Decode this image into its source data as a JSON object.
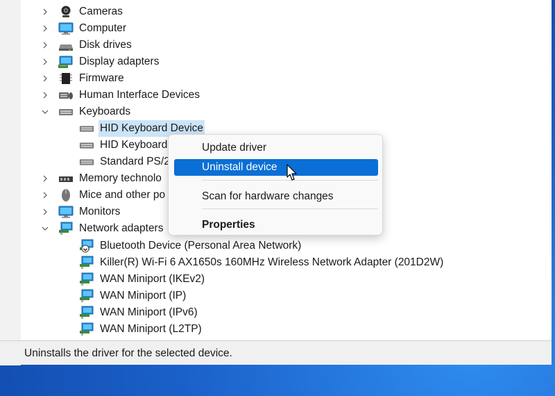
{
  "tree": {
    "categories": [
      {
        "label": "Cameras",
        "icon": "camera-icon",
        "expanded": false
      },
      {
        "label": "Computer",
        "icon": "monitor-icon",
        "expanded": false
      },
      {
        "label": "Disk drives",
        "icon": "disk-drive-icon",
        "expanded": false
      },
      {
        "label": "Display adapters",
        "icon": "display-adapter-icon",
        "expanded": false
      },
      {
        "label": "Firmware",
        "icon": "chip-icon",
        "expanded": false
      },
      {
        "label": "Human Interface Devices",
        "icon": "hid-icon",
        "expanded": false
      },
      {
        "label": "Keyboards",
        "icon": "keyboard-icon",
        "expanded": true
      },
      {
        "label": "Memory technolo",
        "icon": "memory-icon",
        "expanded": false
      },
      {
        "label": "Mice and other po",
        "icon": "mouse-icon",
        "expanded": false
      },
      {
        "label": "Monitors",
        "icon": "monitor-icon",
        "expanded": false
      },
      {
        "label": "Network adapters",
        "icon": "network-icon",
        "expanded": true
      }
    ],
    "keyboards": [
      {
        "label": "HID Keyboard Device",
        "selected": true
      },
      {
        "label": "HID Keyboard"
      },
      {
        "label": "Standard PS/2"
      }
    ],
    "network_adapters": [
      {
        "label": "Bluetooth Device (Personal Area Network)"
      },
      {
        "label": "Killer(R) Wi-Fi 6 AX1650s 160MHz Wireless Network Adapter (201D2W)"
      },
      {
        "label": "WAN Miniport (IKEv2)"
      },
      {
        "label": "WAN Miniport (IP)"
      },
      {
        "label": "WAN Miniport (IPv6)"
      },
      {
        "label": "WAN Miniport (L2TP)"
      }
    ]
  },
  "context_menu": {
    "update_driver": "Update driver",
    "uninstall_device": "Uninstall device",
    "scan_hardware": "Scan for hardware changes",
    "properties": "Properties"
  },
  "status_bar": {
    "text": "Uninstalls the driver for the selected device."
  },
  "colors": {
    "menu_highlight": "#0a6fd6",
    "selection": "#cce4f7",
    "desktop": "#1e6fd8"
  }
}
